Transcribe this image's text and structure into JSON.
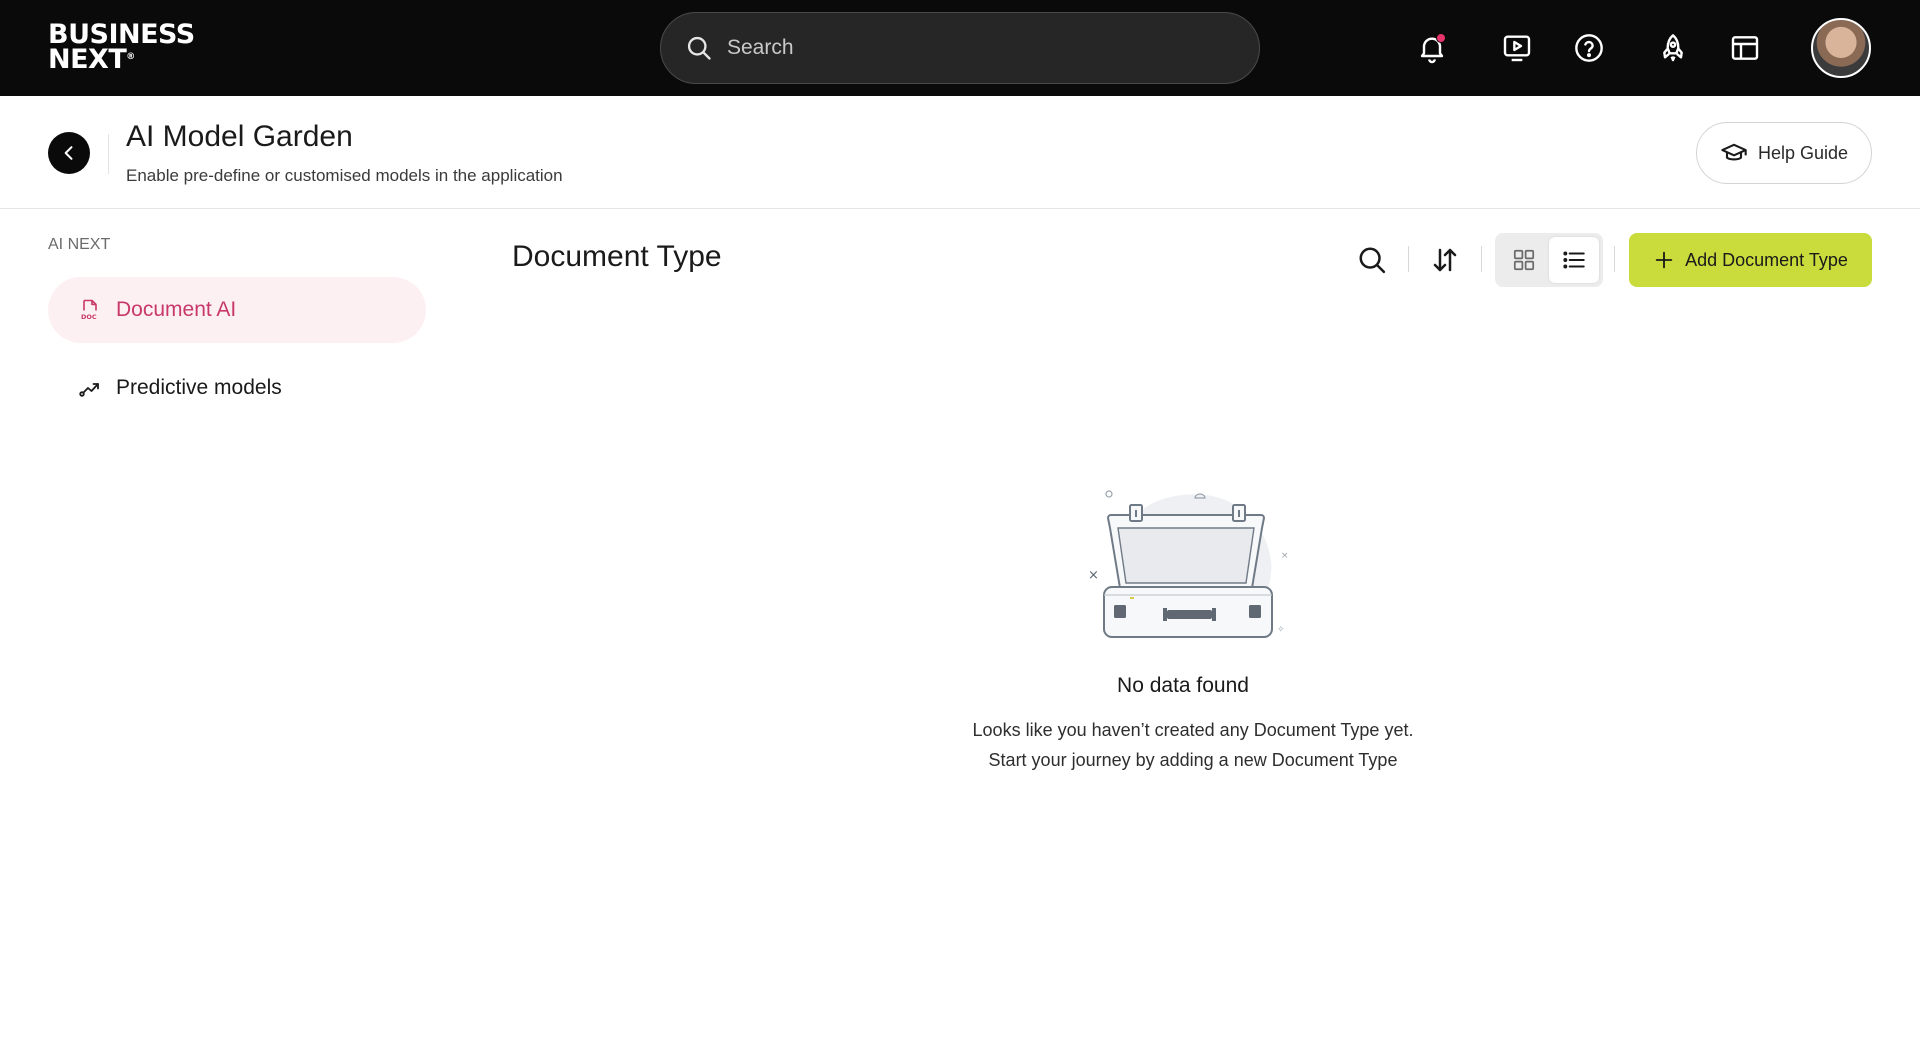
{
  "topbar": {
    "logo_line1": "BUSINESS",
    "logo_line2": "NEXT",
    "logo_mark": "®",
    "search_placeholder": "Search",
    "icons": [
      "notification-bell-icon",
      "video-play-icon",
      "help-circle-icon",
      "rocket-icon",
      "layout-icon"
    ],
    "notification_dot_color": "#e8346b"
  },
  "header": {
    "title": "AI Model Garden",
    "subtitle": "Enable pre-define or customised models in the application",
    "help_guide_label": "Help Guide"
  },
  "sidebar": {
    "section_label": "AI NEXT",
    "items": [
      {
        "label": "Document AI",
        "icon": "doc-file-icon",
        "active": true
      },
      {
        "label": "Predictive models",
        "icon": "trend-icon",
        "active": false
      }
    ]
  },
  "main": {
    "title": "Document Type",
    "add_button_label": "Add Document Type",
    "view_mode": "list",
    "empty_state": {
      "title": "No data found",
      "line1": "Looks like you haven’t created any Document Type yet.",
      "line2": "Start your journey by adding a new Document Type"
    }
  },
  "colors": {
    "topbar_bg": "#0a0a0a",
    "accent_pink": "#c8386a",
    "active_bg": "#fdf0f3",
    "add_button_bg": "#c9dc3c"
  }
}
